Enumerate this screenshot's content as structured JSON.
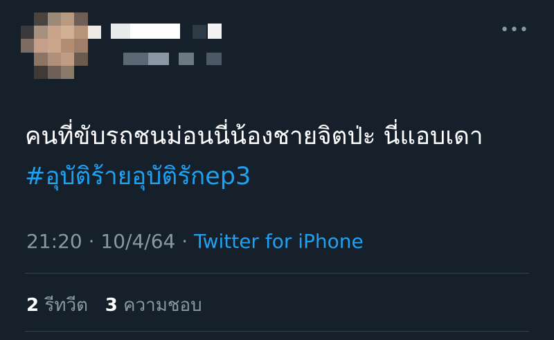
{
  "tweet": {
    "menu_glyph": "•••",
    "text": "คนที่ขับรถชนม่อนนี่น้องชายจิตป่ะ นี่แอบเดา",
    "hashtag": "#อุบัติร้ายอุบัติรักep3",
    "time": "21:20",
    "date": "10/4/64",
    "separator": "·",
    "source": "Twitter for iPhone"
  },
  "stats": {
    "retweets_count": "2",
    "retweets_label": "รีทวีต",
    "likes_count": "3",
    "likes_label": "ความชอบ"
  },
  "colors": {
    "background": "#15202b",
    "text": "#ffffff",
    "secondary": "#8899a6",
    "accent": "#1da1f2",
    "divider": "#38444d"
  }
}
